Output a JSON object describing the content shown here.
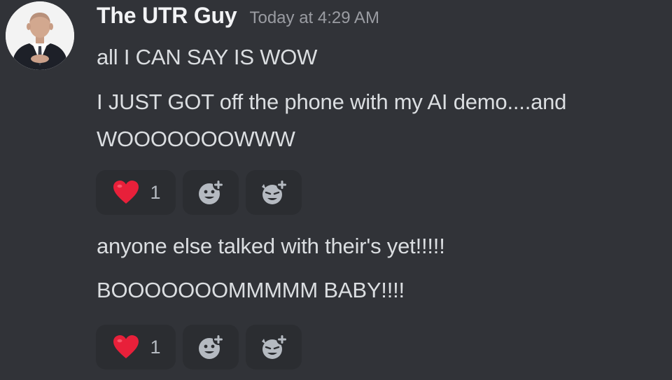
{
  "author": {
    "name": "The UTR Guy",
    "timestamp": "Today at 4:29 AM",
    "avatar_icon": "man-in-suit-avatar"
  },
  "messages": [
    {
      "text": "all I CAN SAY IS WOW"
    },
    {
      "text": "I JUST GOT off the phone with my AI demo....and"
    },
    {
      "text": "WOOOOOOOWWW"
    },
    {
      "text": "anyone else talked with their's yet!!!!!"
    },
    {
      "text": "BOOOOOOOMMMMM BABY!!!!"
    }
  ],
  "reaction_groups": [
    {
      "reactions": [
        {
          "emoji": "heart-emoji",
          "count": "1"
        },
        {
          "emoji": "add-reaction-icon"
        },
        {
          "emoji": "add-super-reaction-icon"
        }
      ]
    },
    {
      "reactions": [
        {
          "emoji": "heart-emoji",
          "count": "1"
        },
        {
          "emoji": "add-reaction-icon"
        },
        {
          "emoji": "add-super-reaction-icon"
        }
      ]
    }
  ],
  "colors": {
    "background": "#313338",
    "reaction_bg": "#2b2d31",
    "username": "#f2f3f5",
    "text": "#dbdee1",
    "timestamp": "#9a9ca2",
    "heart": "#e8203a"
  }
}
